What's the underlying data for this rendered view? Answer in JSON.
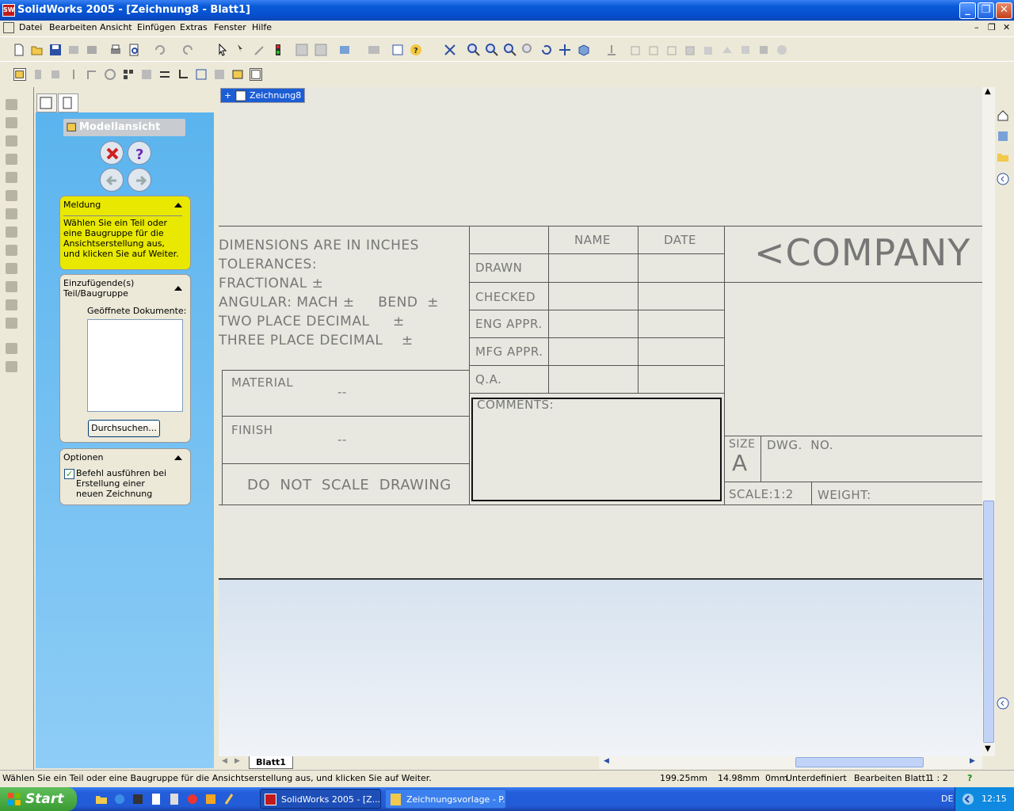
{
  "window": {
    "title": "SolidWorks 2005 - [Zeichnung8 - Blatt1]",
    "app_icon": "SW"
  },
  "menu": [
    "Datei",
    "Bearbeiten",
    "Ansicht",
    "Einfügen",
    "Extras",
    "Fenster",
    "Hilfe"
  ],
  "doc_tab": {
    "label": "Zeichnung8"
  },
  "property_manager": {
    "title": "Modellansicht",
    "message_box": {
      "header": "Meldung",
      "text": "Wählen Sie ein Teil oder eine Baugruppe für die Ansichtserstellung aus, und klicken Sie auf Weiter."
    },
    "part_box": {
      "header": "Einzufügende(s) Teil/Baugruppe",
      "open_docs_label": "Geöffnete Dokumente:",
      "browse_button": "Durchsuchen..."
    },
    "options_box": {
      "header": "Optionen",
      "checkbox_label": "Befehl ausführen bei Erstellung einer neuen Zeichnung",
      "checked": true
    }
  },
  "title_block": {
    "dim_lines": [
      "DIMENSIONS ARE IN INCHES",
      "TOLERANCES:",
      "FRACTIONAL ±",
      "ANGULAR: MACH ±     BEND  ±",
      "TWO PLACE DECIMAL     ±",
      "THREE PLACE DECIMAL    ±"
    ],
    "col_name": "NAME",
    "col_date": "DATE",
    "rows": [
      "DRAWN",
      "CHECKED",
      "ENG APPR.",
      "MFG APPR.",
      "Q.A."
    ],
    "company": "<COMPANY",
    "material_label": "MATERIAL",
    "material_value": "--",
    "finish_label": "FINISH",
    "finish_value": "--",
    "comments": "COMMENTS:",
    "do_not_scale": "DO  NOT  SCALE  DRAWING",
    "size_label": "SIZE",
    "size_value": "A",
    "dwg_no": "DWG.  NO.",
    "scale": "SCALE:1:2",
    "weight": "WEIGHT:"
  },
  "sheet_tab": "Blatt1",
  "status": {
    "message": "Wählen Sie ein Teil oder eine Baugruppe für die Ansichtserstellung aus, und klicken Sie auf Weiter.",
    "x": "199.25mm",
    "y": "14.98mm",
    "z": "0mm",
    "state": "Unterdefiniert",
    "edit": "Bearbeiten Blatt1",
    "scale": "1 : 2",
    "help": "?"
  },
  "taskbar": {
    "start": "Start",
    "tasks": [
      "SolidWorks 2005 - [Z...",
      "Zeichnungsvorlage - P..."
    ],
    "lang": "DE",
    "clock": "12:15"
  }
}
